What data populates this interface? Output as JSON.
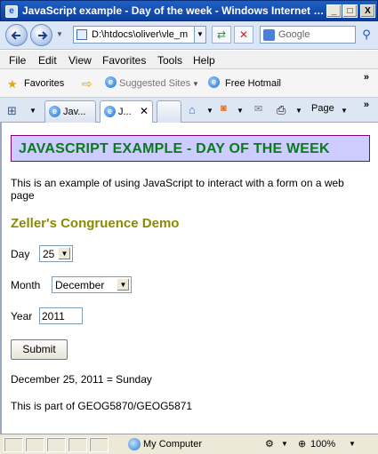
{
  "window": {
    "title": "JavaScript example - Day of the week - Windows Internet Explorer",
    "minimize": "_",
    "maximize": "□",
    "close": "X"
  },
  "address": {
    "url": "D:\\htdocs\\oliver\\vle_m",
    "search_placeholder": "Google"
  },
  "menu": [
    "File",
    "Edit",
    "View",
    "Favorites",
    "Tools",
    "Help"
  ],
  "favorites_bar": {
    "favorites_label": "Favorites",
    "suggested_sites": "Suggested Sites",
    "hotmail": "Free Hotmail",
    "more": "»"
  },
  "tabs": [
    {
      "label": "Jav..."
    },
    {
      "label": "J..."
    }
  ],
  "command_bar": {
    "page_label": "Page",
    "more": "»"
  },
  "page": {
    "heading": "JavaScript example - Day of the week",
    "intro": "This is an example of using JavaScript to interact with a form on a web page",
    "demo_title": "Zeller's Congruence Demo",
    "day_label": "Day",
    "day_value": "25",
    "month_label": "Month",
    "month_value": "December",
    "year_label": "Year",
    "year_value": "2011",
    "submit_label": "Submit",
    "result": "December 25, 2011 = Sunday",
    "footnote": "This is part of GEOG5870/GEOG5871"
  },
  "status": {
    "zone": "My Computer",
    "zoom": "100%"
  }
}
